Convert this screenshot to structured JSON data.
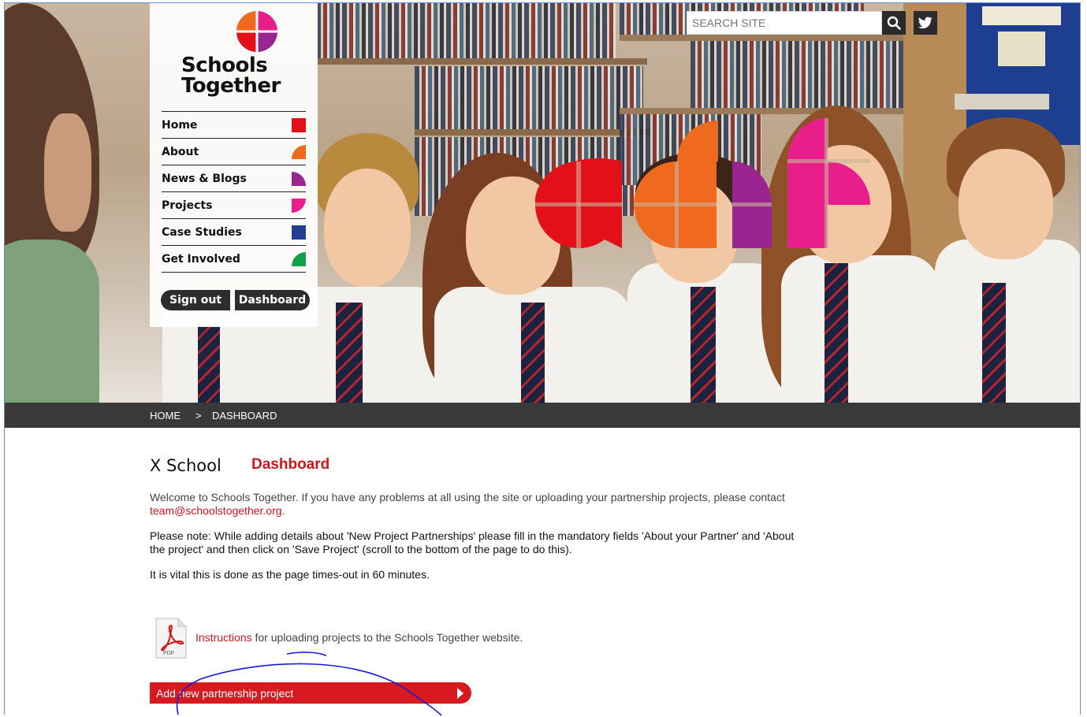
{
  "header": {
    "logo_text_line1": "Schools",
    "logo_text_line2": "Together",
    "search_placeholder": "SEARCH SITE",
    "search_icon": "search-icon",
    "twitter_icon": "twitter-icon"
  },
  "nav": {
    "items": [
      {
        "label": "Home",
        "color": "#e3101a",
        "shape": "square"
      },
      {
        "label": "About",
        "color": "#ef6a1f",
        "shape": "quarter-circle"
      },
      {
        "label": "News & Blogs",
        "color": "#9b2590",
        "shape": "half-circle"
      },
      {
        "label": "Projects",
        "color": "#e81f8a",
        "shape": "half-circle-down"
      },
      {
        "label": "Case Studies",
        "color": "#233f94",
        "shape": "square"
      },
      {
        "label": "Get Involved",
        "color": "#12a04a",
        "shape": "quarter-circle"
      }
    ],
    "signout_label": "Sign out",
    "dashboard_label": "Dashboard"
  },
  "breadcrumb": {
    "home": "HOME",
    "separator": ">",
    "current": "DASHBOARD"
  },
  "main": {
    "school_name": "X School",
    "page_title": "Dashboard",
    "welcome_text": "Welcome to Schools Together. If you have any problems at all using the site or uploading your partnership projects, please contact ",
    "contact_email": "team@schoolstogether.org",
    "welcome_end": ".",
    "note_text": "Please note:  While adding details about 'New Project Partnerships' please fill in the mandatory fields 'About your Partner' and 'About the project' and then click on 'Save Project' (scroll to the bottom of the page to do this).",
    "timeout_text": "It is vital this is done as the page times-out in 60 minutes.",
    "pdf_label": "PDF",
    "instructions_link": "Instructions",
    "instructions_rest": " for uploading projects to the Schools Together website.",
    "add_project_label": "Add new partnership project"
  },
  "colors": {
    "accent_red": "#d71920",
    "bar_dark": "#393939",
    "annotation_blue": "#1a1ad6"
  }
}
